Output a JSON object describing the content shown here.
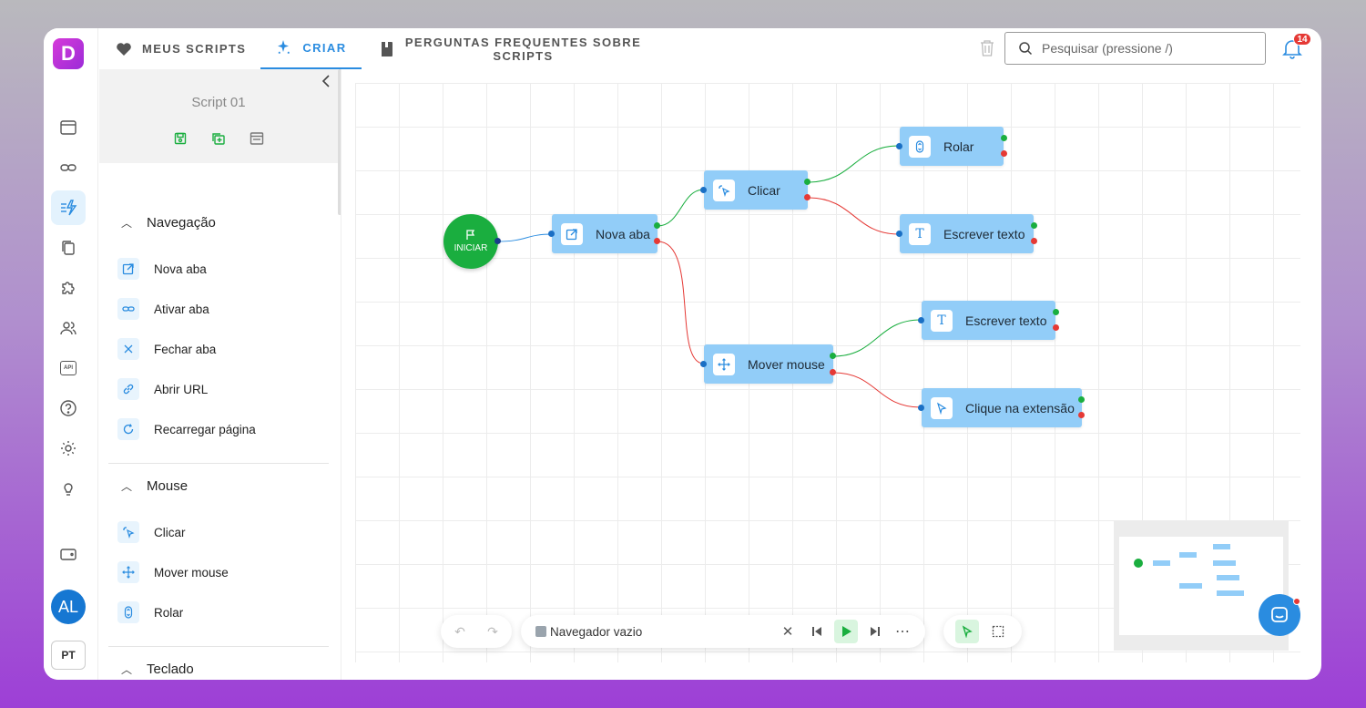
{
  "app": {
    "logo_letter": "D",
    "accent": "#2a8ce0",
    "start_color": "#1aae3f"
  },
  "tabs": [
    {
      "label": "MEUS SCRIPTS",
      "icon": "heart-icon"
    },
    {
      "label": "CRIAR",
      "icon": "sparkle-icon"
    },
    {
      "label": "PERGUNTAS FREQUENTES SOBRE SCRIPTS",
      "icon": "book-icon"
    }
  ],
  "search": {
    "placeholder": "Pesquisar (pressione /)"
  },
  "notifications": {
    "count": "14"
  },
  "rail": {
    "items": [
      "browser-icon",
      "link-icon",
      "automation-icon",
      "copy-icon",
      "puzzle-icon",
      "users-icon",
      "api-icon",
      "help-icon",
      "settings-icon",
      "bulb-icon",
      "wallet-icon"
    ],
    "api_label": "API",
    "avatar": "AL",
    "lang": "PT"
  },
  "sidebar": {
    "script_name": "Script 01",
    "sections": [
      {
        "title": "Navegação",
        "items": [
          "Nova aba",
          "Ativar aba",
          "Fechar aba",
          "Abrir URL",
          "Recarregar página"
        ]
      },
      {
        "title": "Mouse",
        "items": [
          "Clicar",
          "Mover mouse",
          "Rolar"
        ]
      },
      {
        "title": "Teclado"
      }
    ]
  },
  "flow": {
    "start_label": "INICIAR",
    "nodes": {
      "nova_aba": "Nova aba",
      "clicar": "Clicar",
      "rolar": "Rolar",
      "escrever1": "Escrever texto",
      "mover": "Mover mouse",
      "escrever2": "Escrever texto",
      "clique_ext": "Clique na extensão"
    }
  },
  "bottom": {
    "browser_status": "Navegador vazio"
  }
}
